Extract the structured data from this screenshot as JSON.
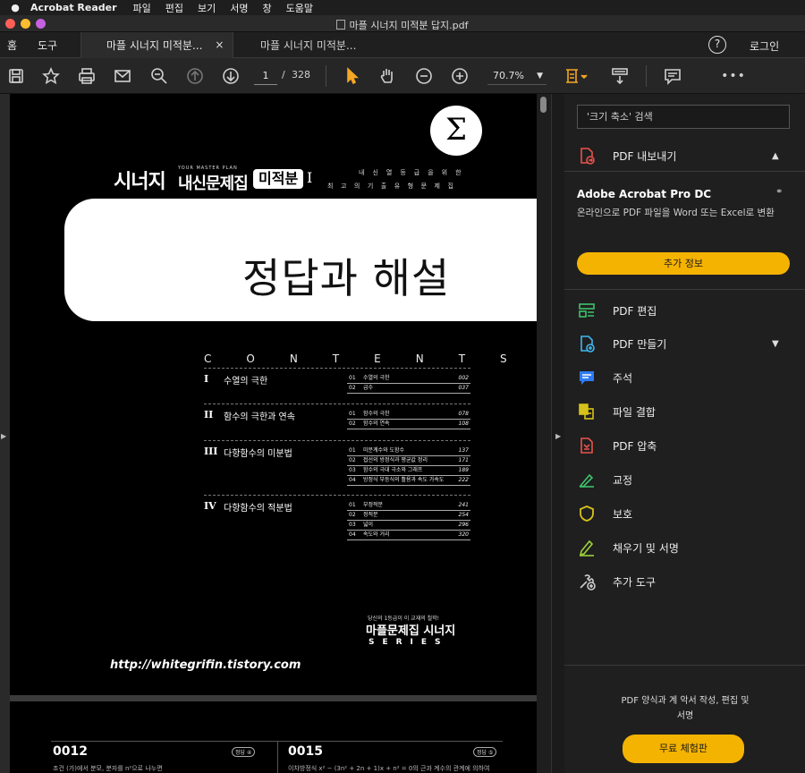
{
  "menubar": {
    "app_name": "Acrobat Reader",
    "items": [
      "파일",
      "편집",
      "보기",
      "서명",
      "창",
      "도움말"
    ]
  },
  "window": {
    "title": "마플 시너지 미적분 답지.pdf"
  },
  "tabs": {
    "home": "홈",
    "tools": "도구",
    "docs": [
      {
        "label": "마플 시너지 미적분...",
        "active": true,
        "close": "×"
      },
      {
        "label": "마플 시너지 미적분...",
        "active": false
      }
    ],
    "help": "?",
    "login": "로그인"
  },
  "toolbar": {
    "page_current": "1",
    "page_separator": "/",
    "page_total": "328",
    "zoom": "70.7%",
    "icons": [
      "save-icon",
      "star-icon",
      "print-icon",
      "mail-icon",
      "zoom-search-icon",
      "page-up-icon",
      "page-down-icon",
      "select-cursor-icon",
      "hand-icon",
      "zoom-out-icon",
      "zoom-in-icon",
      "fit-page-icon",
      "scroll-mode-icon",
      "comment-icon",
      "more-icon"
    ],
    "more": "•••"
  },
  "document": {
    "sigma": "Σ",
    "brand": {
      "name": "시너지",
      "subtitle": "YOUR MASTER PLAN",
      "main": "내신문제집",
      "badge": "미적분",
      "numeral": "I",
      "right_line1": "내신열등급을위한",
      "right_line2": "최고의기출유형문제집"
    },
    "title": "정답과 해설",
    "contents_label": "CONTENTS",
    "sections": [
      {
        "num": "I",
        "title": "수열의 극한",
        "items": [
          {
            "n": "01",
            "t": "수열의 극한",
            "p": "002"
          },
          {
            "n": "02",
            "t": "급수",
            "p": "037"
          }
        ]
      },
      {
        "num": "II",
        "title": "함수의 극한과 연속",
        "items": [
          {
            "n": "01",
            "t": "함수의 극한",
            "p": "078"
          },
          {
            "n": "02",
            "t": "함수의 연속",
            "p": "108"
          }
        ]
      },
      {
        "num": "III",
        "title": "다항함수의 미분법",
        "items": [
          {
            "n": "01",
            "t": "미분계수와 도함수",
            "p": "137"
          },
          {
            "n": "02",
            "t": "접선의 방정식과 평균값 정리",
            "p": "171"
          },
          {
            "n": "03",
            "t": "함수의 극대 극소와 그래프",
            "p": "189"
          },
          {
            "n": "04",
            "t": "방정식 부등식의 활용과 속도 가속도",
            "p": "222"
          }
        ]
      },
      {
        "num": "IV",
        "title": "다항함수의 적분법",
        "items": [
          {
            "n": "01",
            "t": "부정적분",
            "p": "241"
          },
          {
            "n": "02",
            "t": "정적분",
            "p": "254"
          },
          {
            "n": "03",
            "t": "넓이",
            "p": "296"
          },
          {
            "n": "04",
            "t": "속도와 거리",
            "p": "320"
          }
        ]
      }
    ],
    "series_small": "당신의 1등급이 이 교재의 철학!",
    "series_main": "마플문제집 시너지",
    "series_label": "SERIES",
    "url": "http://whitegrifin.tistory.com",
    "page2": {
      "left_num": "0012",
      "left_badge": "정답 ④",
      "left_text": "조건 (가)에서 분모, 분자를 n²으로 나누면",
      "right_num": "0015",
      "right_badge": "정답 ⑤",
      "right_text": "이차방정식 x² − (3n² + 2n + 1)x + n² = 0의 근과 계수의 관계에 의하여"
    }
  },
  "panel": {
    "search_placeholder": "'크기 축소' 검색",
    "export": {
      "label": "PDF 내보내기",
      "chevron": "^"
    },
    "promo": {
      "title": "Adobe Acrobat Pro DC",
      "desc": "온라인으로 PDF 파일을 Word 또는 Excel로 변환",
      "button": "추가 정보"
    },
    "tools": [
      {
        "label": "PDF 편집",
        "icon": "edit-pdf-icon",
        "color": "#3ec46d"
      },
      {
        "label": "PDF 만들기",
        "icon": "create-pdf-icon",
        "color": "#3fb8f0",
        "chevron": "v"
      },
      {
        "label": "주석",
        "icon": "comment-tool-icon",
        "color": "#2e7cf6"
      },
      {
        "label": "파일 결합",
        "icon": "combine-files-icon",
        "color": "#d6c21a"
      },
      {
        "label": "PDF 압축",
        "icon": "compress-pdf-icon",
        "color": "#e8534b"
      },
      {
        "label": "교정",
        "icon": "redact-icon",
        "color": "#3ec46d"
      },
      {
        "label": "보호",
        "icon": "protect-icon",
        "color": "#d6c21a"
      },
      {
        "label": "채우기 및 서명",
        "icon": "fill-sign-icon",
        "color": "#9bd13a"
      },
      {
        "label": "추가 도구",
        "icon": "more-tools-icon",
        "color": "#cccccc"
      }
    ],
    "bottom_text": "PDF 양식과 계 악서 작성, 편집 및 서명",
    "trial_button": "무료 체험판"
  },
  "colors": {
    "accent_yellow": "#f5b301",
    "background": "#1f1f1f",
    "page_black": "#000000"
  }
}
